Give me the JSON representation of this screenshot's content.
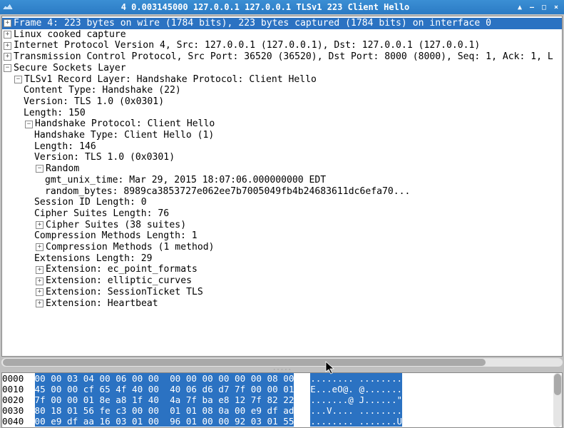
{
  "titlebar": {
    "title": "4 0.003145000 127.0.0.1 127.0.0.1 TLSv1 223 Client Hello"
  },
  "tree": {
    "frame": "Frame 4: 223 bytes on wire (1784 bits), 223 bytes captured (1784 bits) on interface 0",
    "linux": "Linux cooked capture",
    "ip": "Internet Protocol Version 4, Src: 127.0.0.1 (127.0.0.1), Dst: 127.0.0.1 (127.0.0.1)",
    "tcp": "Transmission Control Protocol, Src Port: 36520 (36520), Dst Port: 8000 (8000), Seq: 1, Ack: 1, L",
    "ssl": "Secure Sockets Layer",
    "record": "TLSv1 Record Layer: Handshake Protocol: Client Hello",
    "content_type": "Content Type: Handshake (22)",
    "version1": "Version: TLS 1.0 (0x0301)",
    "length1": "Length: 150",
    "handshake": "Handshake Protocol: Client Hello",
    "handshake_type": "Handshake Type: Client Hello (1)",
    "length2": "Length: 146",
    "version2": "Version: TLS 1.0 (0x0301)",
    "random": "Random",
    "gmt": "gmt_unix_time: Mar 29, 2015 18:07:06.000000000 EDT",
    "random_bytes": "random_bytes: 8989ca3853727e062ee7b7005049fb4b24683611dc6efa70...",
    "session_id": "Session ID Length: 0",
    "cipher_len": "Cipher Suites Length: 76",
    "cipher_suites": "Cipher Suites (38 suites)",
    "compress_len": "Compression Methods Length: 1",
    "compress": "Compression Methods (1 method)",
    "ext_len": "Extensions Length: 29",
    "ext1": "Extension: ec_point_formats",
    "ext2": "Extension: elliptic_curves",
    "ext3": "Extension: SessionTicket TLS",
    "ext4": "Extension: Heartbeat"
  },
  "hex": {
    "rows": [
      {
        "off": "0000",
        "b1": "00 00 03 04 00 06 00 00",
        "b2": "00 00 00 00 00 00 08 00",
        "asc": "........ ........"
      },
      {
        "off": "0010",
        "b1": "45 00 00 cf 65 4f 40 00",
        "b2": "40 06 d6 d7 7f 00 00 01",
        "asc": "E...eO@. @......."
      },
      {
        "off": "0020",
        "b1": "7f 00 00 01 8e a8 1f 40",
        "b2": "4a 7f ba e8 12 7f 82 22",
        "asc": ".......@ J......\""
      },
      {
        "off": "0030",
        "b1": "80 18 01 56 fe c3 00 00",
        "b2": "01 01 08 0a 00 e9 df ad",
        "asc": "...V.... ........"
      },
      {
        "off": "0040",
        "b1": "00 e9 df aa 16 03 01 00",
        "b2": "96 01 00 00 92 03 01 55",
        "asc": "........ .......U"
      }
    ]
  }
}
